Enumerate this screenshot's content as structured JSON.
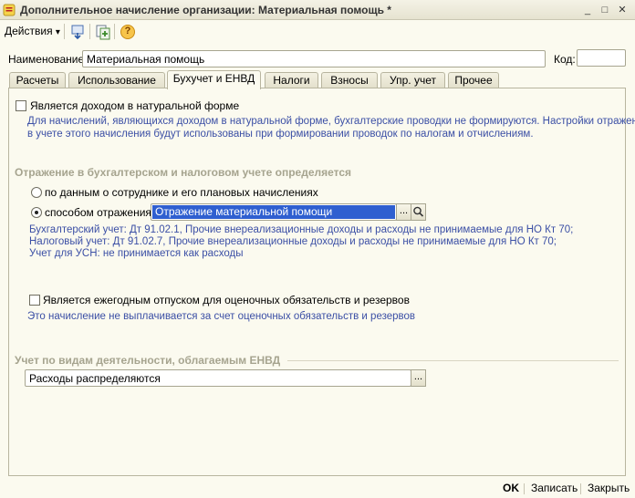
{
  "window": {
    "title": "Дополнительное начисление организации: Материальная помощь *",
    "controls": [
      "_",
      "□",
      "✕"
    ]
  },
  "toolbar": {
    "actions_label": "Действия",
    "actions_arrow": "▾",
    "help_glyph": "?"
  },
  "form": {
    "name_label": "Наименование:",
    "name_value": "Материальная помощь",
    "code_label": "Код:",
    "code_value": ""
  },
  "tabs": [
    {
      "label": "Расчеты"
    },
    {
      "label": "Использование"
    },
    {
      "label": "Бухучет и ЕНВД"
    },
    {
      "label": "Налоги"
    },
    {
      "label": "Взносы"
    },
    {
      "label": "Упр. учет"
    },
    {
      "label": "Прочее"
    }
  ],
  "active_tab": "Бухучет и ЕНВД",
  "bukh": {
    "natural_form_label": "Является доходом в натуральной форме",
    "natural_form_checked": false,
    "natural_form_note_1": "Для начислений, являющихся доходом в натуральной форме, бухгалтерские проводки не формируются. Настройки отражения",
    "natural_form_note_2": "в учете этого начисления будут использованы при формировании проводок по налогам и отчислениям.",
    "reflection_section": "Отражение в бухгалтерском и налоговом учете определяется",
    "radio_by_employee": "по данным о сотруднике и его плановых начислениях",
    "radio_by_method": "способом отражения:",
    "selected_radio": "by_method",
    "method_value": "Отражение материальной помощи",
    "accounting_line": "Бухгалтерский учет: Дт 91.02.1, Прочие внереализационные доходы и расходы не принимаемые для НО Кт 70;",
    "tax_line": "Налоговый учет: Дт 91.02.7, Прочие внереализационные доходы и расходы не принимаемые для НО Кт 70;",
    "usn_line": "Учет для УСН: не принимается как расходы",
    "vacation_label": "Является ежегодным отпуском для оценочных обязательств и резервов",
    "vacation_checked": false,
    "vacation_note": "Это начисление не выплачивается за счет оценочных обязательств и резервов",
    "envd_section": "Учет по видам деятельности, облагаемым ЕНВД",
    "envd_value": "Расходы распределяются",
    "select_glyph": "..."
  },
  "footer": {
    "ok": "OK",
    "save": "Записать",
    "close": "Закрыть"
  },
  "colors": {
    "background": "#fbfaef",
    "note_blue": "#3b4fa5",
    "section_gray": "#a6a48f",
    "selection_blue": "#2f5fd0"
  }
}
